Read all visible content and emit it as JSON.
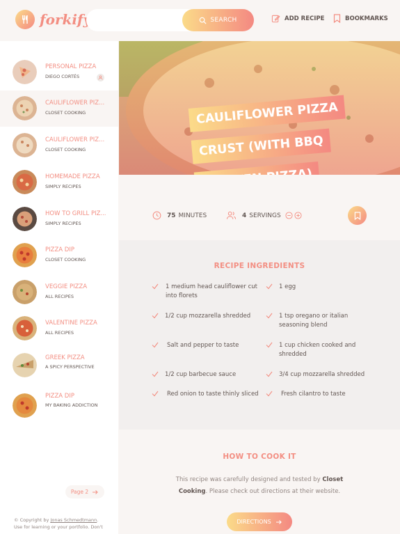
{
  "header": {
    "logo_text": "forkify",
    "search_placeholder": "",
    "search_button": "SEARCH",
    "add_recipe": "ADD RECIPE",
    "bookmarks": "BOOKMARKS"
  },
  "results": [
    {
      "title": "PERSONAL PIZZA",
      "publisher": "DIEGO CORTÉS",
      "user_generated": true
    },
    {
      "title": "CAULIFLOWER PIZ...",
      "publisher": "CLOSET COOKING",
      "active": true
    },
    {
      "title": "CAULIFLOWER PIZ...",
      "publisher": "CLOSET COOKING"
    },
    {
      "title": "HOMEMADE PIZZA",
      "publisher": "SIMPLY RECIPES"
    },
    {
      "title": "HOW TO GRILL PIZ...",
      "publisher": "SIMPLY RECIPES"
    },
    {
      "title": "PIZZA DIP",
      "publisher": "CLOSET COOKING"
    },
    {
      "title": "VEGGIE PIZZA",
      "publisher": "ALL RECIPES"
    },
    {
      "title": "VALENTINE PIZZA",
      "publisher": "ALL RECIPES"
    },
    {
      "title": "GREEK PIZZA",
      "publisher": "A SPICY PERSPECTIVE"
    },
    {
      "title": "PIZZA DIP",
      "publisher": "MY BAKING ADDICTION"
    }
  ],
  "pagination": {
    "next_label": "Page 2"
  },
  "copyright": {
    "prefix": "© Copyright by ",
    "author": "Jonas Schmedtmann",
    "suffix": ". Use for learning or your portfolio. Don't"
  },
  "recipe": {
    "title_lines": [
      "CAULIFLOWER PIZZA",
      "CRUST (WITH BBQ",
      "CHICKEN PIZZA)"
    ],
    "minutes": "75",
    "minutes_label": "MINUTES",
    "servings": "4",
    "servings_label": "SERVINGS",
    "ingredients_title": "RECIPE INGREDIENTS",
    "ingredients": [
      "1 medium head cauliflower cut into florets",
      "1 egg",
      "1/2 cup mozzarella shredded",
      "1 tsp oregano or italian seasoning blend",
      "Salt and pepper to taste",
      "1 cup chicken cooked and shredded",
      "1/2 cup barbecue sauce",
      "3/4 cup mozzarella shredded",
      "Red onion to taste thinly sliced",
      "Fresh cilantro to taste"
    ],
    "cook_title": "HOW TO COOK IT",
    "cook_text_prefix": "This recipe was carefully designed and tested by ",
    "cook_publisher": "Closet Cooking",
    "cook_text_suffix": ". Please check out directions at their website.",
    "directions_button": "DIRECTIONS"
  },
  "colors": {
    "accent": "#f38e82",
    "gradient_start": "#fbdb89",
    "gradient_end": "#f48982"
  }
}
